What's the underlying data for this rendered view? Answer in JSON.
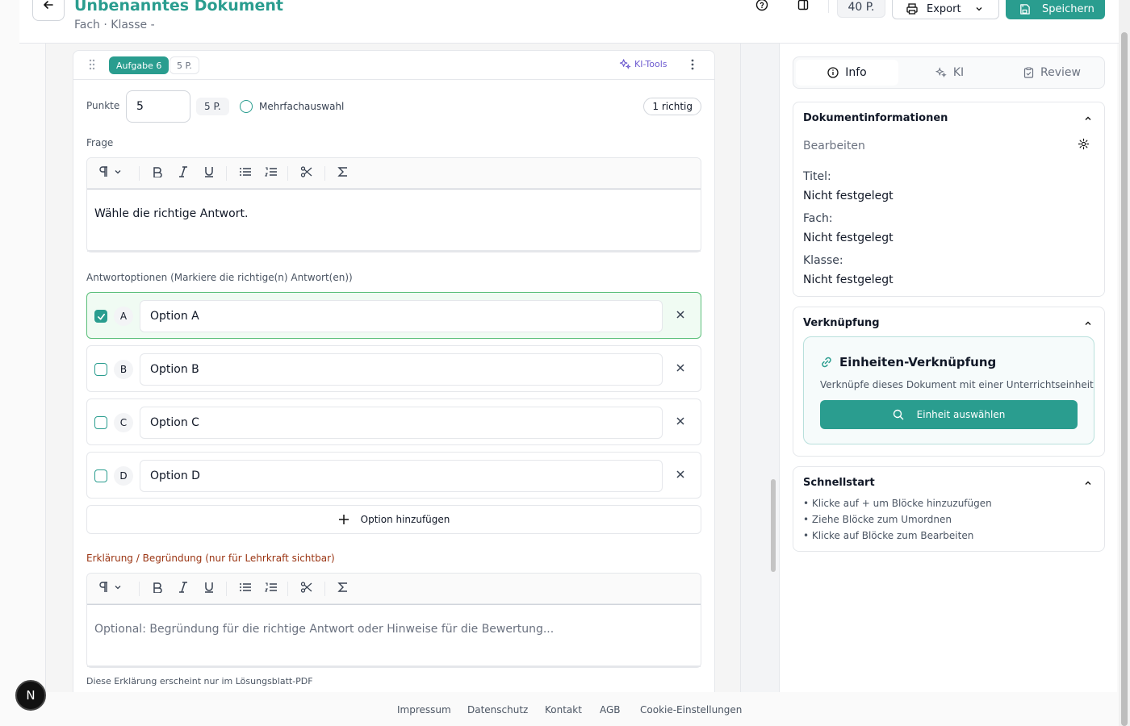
{
  "header": {
    "title": "Unbenanntes Dokument",
    "subtitle": "Fach · Klasse -",
    "points": "40 P.",
    "export_label": "Export",
    "save_label": "Speichern"
  },
  "task": {
    "badge": "Aufgabe 6",
    "points_badge": "5 P.",
    "ki_tools": "KI-Tools",
    "points_label": "Punkte",
    "points_value": "5",
    "points_pill": "5 P.",
    "multi_label": "Mehrfachauswahl",
    "correct_count": "1 richtig",
    "question_label": "Frage",
    "question_text": "Wähle die richtige Antwort.",
    "options_label": "Antwortoptionen (Markiere die richtige(n) Antwort(en))",
    "options": [
      {
        "letter": "A",
        "text": "Option A",
        "correct": true
      },
      {
        "letter": "B",
        "text": "Option B",
        "correct": false
      },
      {
        "letter": "C",
        "text": "Option C",
        "correct": false
      },
      {
        "letter": "D",
        "text": "Option D",
        "correct": false
      }
    ],
    "add_option": "Option hinzufügen",
    "explanation_label": "Erklärung / Begründung (nur für Lehrkraft sichtbar)",
    "explanation_placeholder": "Optional: Begründung für die richtige Antwort oder Hinweise für die Bewertung...",
    "explanation_hint": "Diese Erklärung erscheint nur im Lösungsblatt-PDF"
  },
  "sidebar": {
    "tabs": [
      "Info",
      "KI",
      "Review"
    ],
    "doc_info": {
      "title": "Dokumentinformationen",
      "edit": "Bearbeiten",
      "title_label": "Titel:",
      "title_value": "Nicht festgelegt",
      "subject_label": "Fach:",
      "subject_value": "Nicht festgelegt",
      "class_label": "Klasse:",
      "class_value": "Nicht festgelegt"
    },
    "link": {
      "title": "Verknüpfung",
      "card_title": "Einheiten-Verknüpfung",
      "card_desc": "Verknüpfe dieses Dokument mit einer Unterrichtseinheit",
      "button": "Einheit auswählen"
    },
    "quickstart": {
      "title": "Schnellstart",
      "items": [
        "• Klicke auf + um Blöcke hinzuzufügen",
        "• Ziehe Blöcke zum Umordnen",
        "• Klicke auf Blöcke zum Bearbeiten"
      ]
    }
  },
  "footer": {
    "links": [
      "Impressum",
      "Datenschutz",
      "Kontakt",
      "AGB",
      "Cookie-Einstellungen"
    ]
  },
  "fab_label": "N",
  "colors": {
    "accent": "#2a9d8f",
    "ai": "#6d5bd0",
    "correct_border": "#5bbf7a",
    "explanation_label": "#9a3412"
  }
}
